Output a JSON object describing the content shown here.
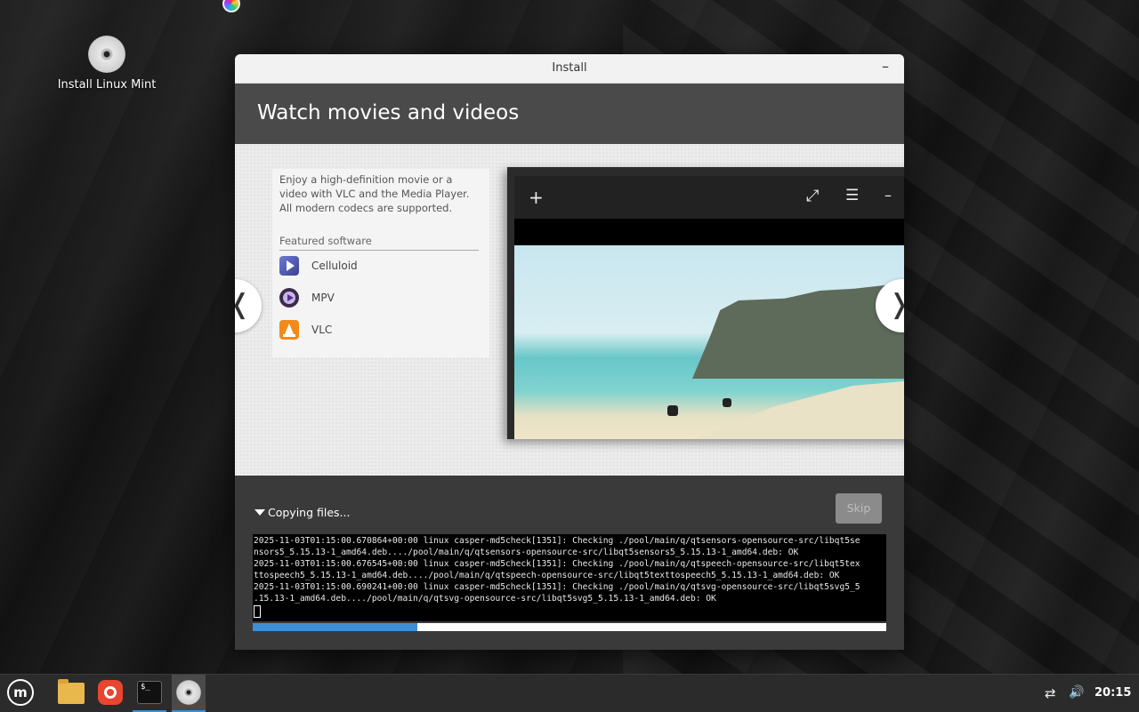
{
  "desktop": {
    "icon_label": "Install Linux Mint"
  },
  "window": {
    "title": "Install",
    "minimize_glyph": "–",
    "heading": "Watch movies and videos"
  },
  "slide": {
    "description": "Enjoy a high-definition movie or a video with VLC and the Media Player. All modern codecs are supported.",
    "featured_label": "Featured software",
    "apps": [
      {
        "name": "Celluloid",
        "icon": "celluloid-icon"
      },
      {
        "name": "MPV",
        "icon": "mpv-icon"
      },
      {
        "name": "VLC",
        "icon": "vlc-icon"
      }
    ],
    "prev_glyph": "❬",
    "next_glyph": "❭",
    "player_controls": {
      "add": "+",
      "fullscreen": "⤢",
      "menu": "☰",
      "minimize": "–"
    }
  },
  "progress": {
    "status": "Copying files...",
    "skip_label": "Skip",
    "log_lines": [
      "2025-11-03T01:15:00.670864+00:00 linux casper-md5check[1351]: Checking ./pool/main/q/qtsensors-opensource-src/libqt5se",
      "nsors5_5.15.13-1_amd64.deb..../pool/main/q/qtsensors-opensource-src/libqt5sensors5_5.15.13-1_amd64.deb: OK",
      "2025-11-03T01:15:00.676545+00:00 linux casper-md5check[1351]: Checking ./pool/main/q/qtspeech-opensource-src/libqt5tex",
      "ttospeech5_5.15.13-1_amd64.deb..../pool/main/q/qtspeech-opensource-src/libqt5texttospeech5_5.15.13-1_amd64.deb: OK",
      "2025-11-03T01:15:00.690241+00:00 linux casper-md5check[1351]: Checking ./pool/main/q/qtsvg-opensource-src/libqt5svg5_5",
      ".15.13-1_amd64.deb..../pool/main/q/qtsvg-opensource-src/libqt5svg5_5.15.13-1_amd64.deb: OK"
    ],
    "fraction": 0.26
  },
  "taskbar": {
    "menu_glyph": "m",
    "terminal_glyph": "$_",
    "network_glyph": "⇄",
    "volume_glyph": "🔊",
    "clock": "20:15"
  },
  "colors": {
    "accent": "#3a8fd8",
    "header_bg": "#4a4a4a",
    "window_bg": "#3a3a3a"
  }
}
